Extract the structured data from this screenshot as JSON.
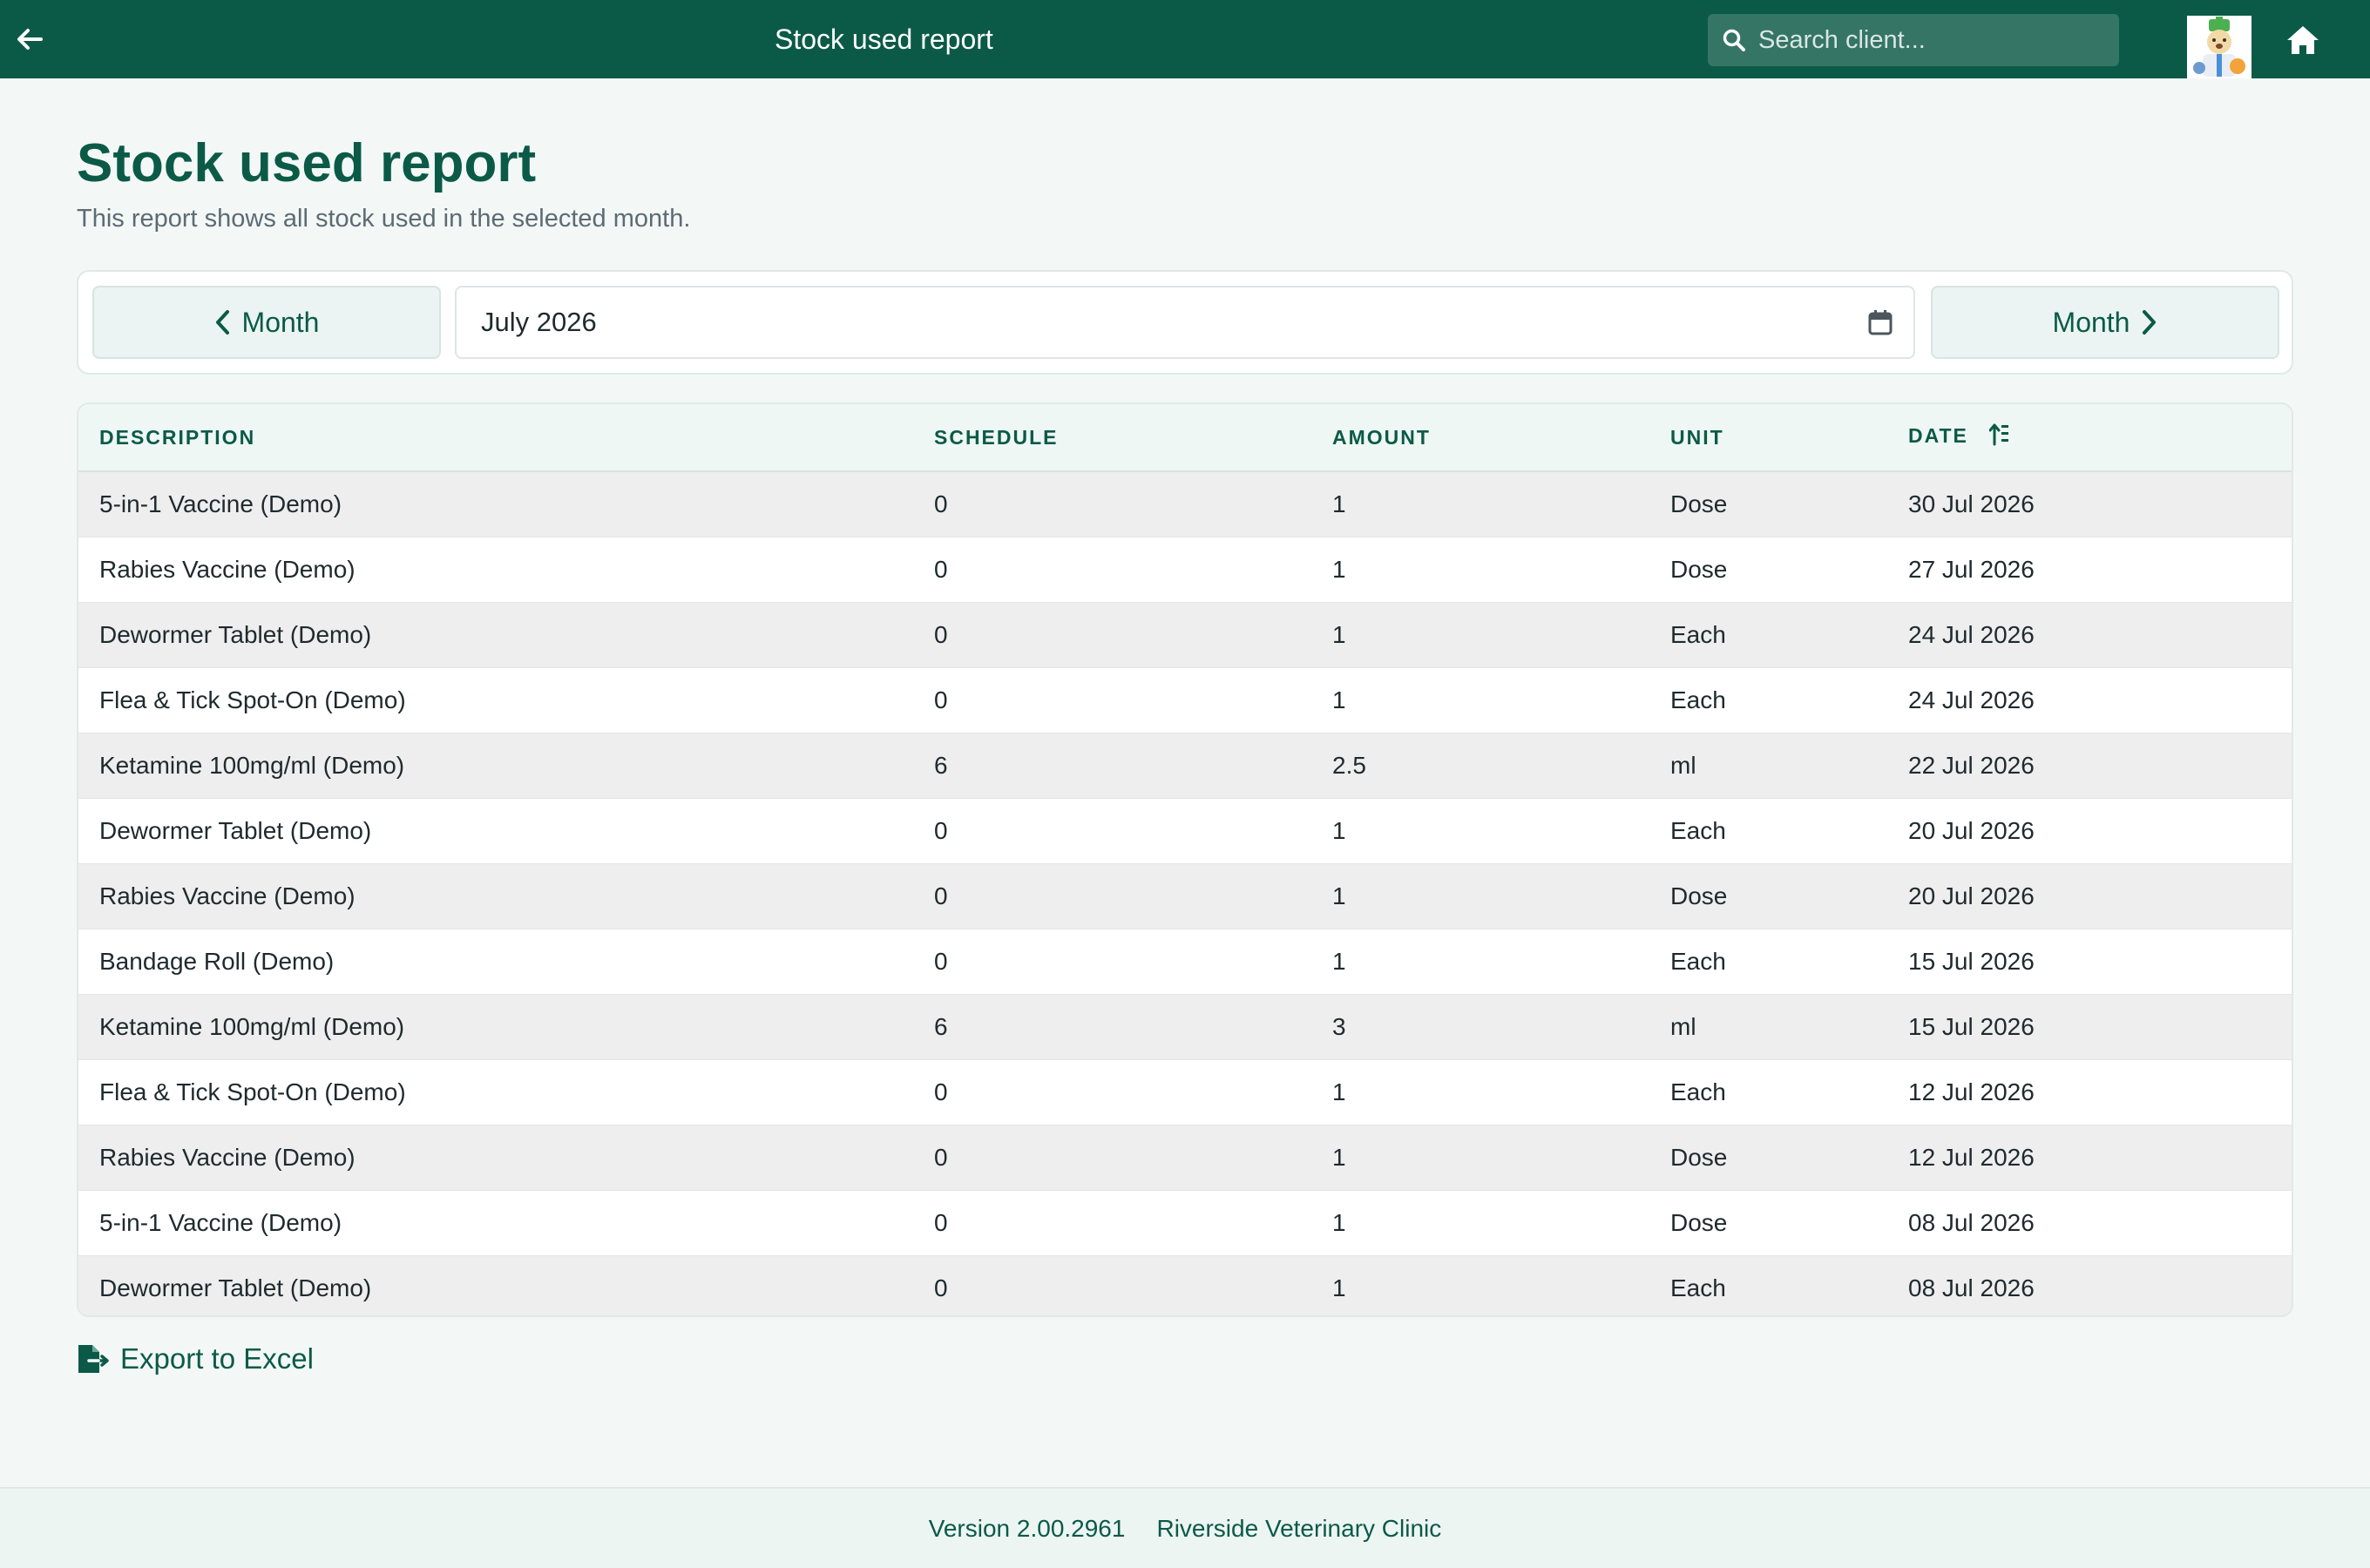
{
  "topbar": {
    "title": "Stock used report",
    "search_placeholder": "Search client...",
    "back_icon": "arrow-left-icon",
    "search_icon": "search-icon",
    "home_icon": "home-icon",
    "avatar_icon": "clinic-logo-avatar"
  },
  "header": {
    "title": "Stock used report",
    "subtitle": "This report shows all stock used in the selected month."
  },
  "month_picker": {
    "prev_label": "Month",
    "next_label": "Month",
    "selected_month": "July 2026",
    "calendar_icon": "calendar-icon"
  },
  "table": {
    "columns": [
      "DESCRIPTION",
      "SCHEDULE",
      "AMOUNT",
      "UNIT",
      "DATE"
    ],
    "sort_column": "DATE",
    "rows": [
      {
        "description": "5-in-1 Vaccine (Demo)",
        "schedule": "0",
        "amount": "1",
        "unit": "Dose",
        "date": "30 Jul 2026"
      },
      {
        "description": "Rabies Vaccine (Demo)",
        "schedule": "0",
        "amount": "1",
        "unit": "Dose",
        "date": "27 Jul 2026"
      },
      {
        "description": "Dewormer Tablet (Demo)",
        "schedule": "0",
        "amount": "1",
        "unit": "Each",
        "date": "24 Jul 2026"
      },
      {
        "description": "Flea & Tick Spot-On (Demo)",
        "schedule": "0",
        "amount": "1",
        "unit": "Each",
        "date": "24 Jul 2026"
      },
      {
        "description": "Ketamine 100mg/ml (Demo)",
        "schedule": "6",
        "amount": "2.5",
        "unit": "ml",
        "date": "22 Jul 2026"
      },
      {
        "description": "Dewormer Tablet (Demo)",
        "schedule": "0",
        "amount": "1",
        "unit": "Each",
        "date": "20 Jul 2026"
      },
      {
        "description": "Rabies Vaccine (Demo)",
        "schedule": "0",
        "amount": "1",
        "unit": "Dose",
        "date": "20 Jul 2026"
      },
      {
        "description": "Bandage Roll (Demo)",
        "schedule": "0",
        "amount": "1",
        "unit": "Each",
        "date": "15 Jul 2026"
      },
      {
        "description": "Ketamine 100mg/ml (Demo)",
        "schedule": "6",
        "amount": "3",
        "unit": "ml",
        "date": "15 Jul 2026"
      },
      {
        "description": "Flea & Tick Spot-On (Demo)",
        "schedule": "0",
        "amount": "1",
        "unit": "Each",
        "date": "12 Jul 2026"
      },
      {
        "description": "Rabies Vaccine (Demo)",
        "schedule": "0",
        "amount": "1",
        "unit": "Dose",
        "date": "12 Jul 2026"
      },
      {
        "description": "5-in-1 Vaccine (Demo)",
        "schedule": "0",
        "amount": "1",
        "unit": "Dose",
        "date": "08 Jul 2026"
      },
      {
        "description": "Dewormer Tablet (Demo)",
        "schedule": "0",
        "amount": "1",
        "unit": "Each",
        "date": "08 Jul 2026"
      }
    ]
  },
  "export": {
    "label": "Export to Excel",
    "icon": "file-export-icon"
  },
  "footer": {
    "version": "Version 2.00.2961",
    "clinic": "Riverside Veterinary Clinic"
  },
  "colors": {
    "brand": "#0b5a47",
    "background": "#f3f8f7",
    "row_alt": "#eeeeee"
  }
}
